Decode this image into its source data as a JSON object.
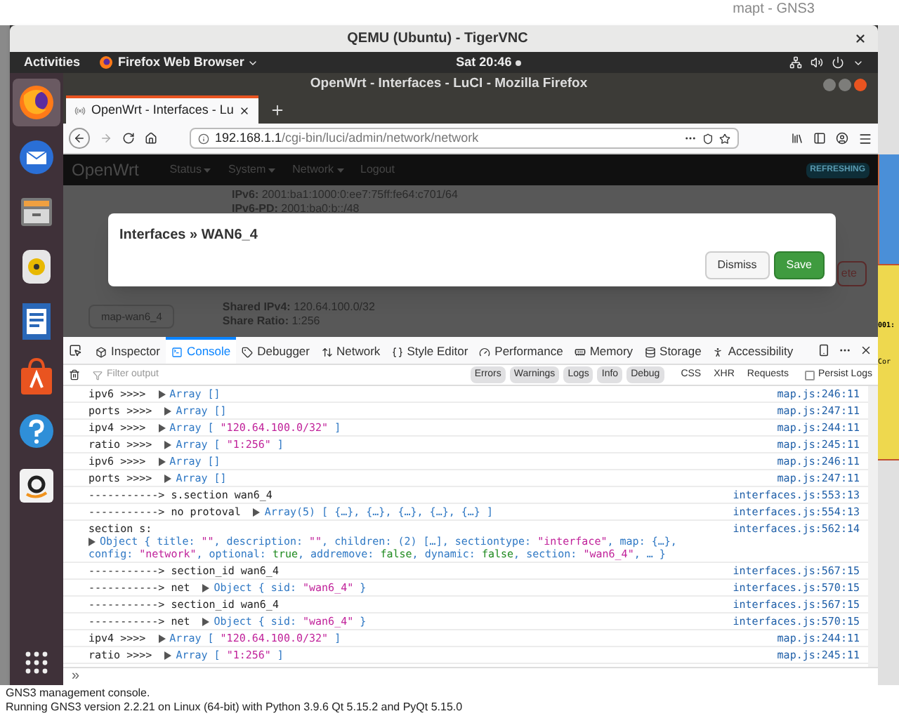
{
  "host": {
    "title": "mapt - GNS3",
    "canvas_labels": [
      "001:",
      "Cor"
    ],
    "console_lines": [
      "GNS3 management console.",
      "Running GNS3 version 2.2.21 on Linux (64-bit) with Python 3.9.6 Qt 5.15.2 and PyQt 5.15.0"
    ]
  },
  "vnc": {
    "title": "QEMU (Ubuntu) - TigerVNC"
  },
  "topbar": {
    "activities": "Activities",
    "app": "Firefox Web Browser",
    "clock": "Sat 20:46"
  },
  "dock": [
    {
      "kind": "firefox",
      "selected": true
    },
    {
      "kind": "mail",
      "selected": false
    },
    {
      "kind": "files",
      "selected": false
    },
    {
      "kind": "speaker",
      "selected": false
    },
    {
      "kind": "document",
      "selected": false
    },
    {
      "kind": "bag",
      "selected": false
    },
    {
      "kind": "help",
      "selected": false
    },
    {
      "kind": "shop",
      "selected": false
    }
  ],
  "browser": {
    "title": "OpenWrt - Interfaces - LuCI - Mozilla Firefox",
    "tab": {
      "title": "OpenWrt - Interfaces - Lu",
      "selected": true
    },
    "url": {
      "host": "192.168.1.1",
      "path": "/cgi-bin/luci/admin/network/network"
    }
  },
  "page": {
    "brand": "OpenWrt",
    "menu": [
      {
        "label": "Status",
        "dropdown": true
      },
      {
        "label": "System",
        "dropdown": true
      },
      {
        "label": "Network",
        "dropdown": true
      },
      {
        "label": "Logout",
        "dropdown": false
      }
    ],
    "badge": "REFRESHING",
    "top_fields": [
      {
        "label": "IPv6:",
        "value": "2001:ba1:1000:0:ee7:75ff:fe64:c701/64"
      },
      {
        "label": "IPv6-PD:",
        "value": "2001:ba0:b::/48"
      }
    ],
    "bottom_fields": [
      {
        "label": "Shared IPv4:",
        "value": "120.64.100.0/32"
      },
      {
        "label": "Share Ratio:",
        "value": "1:256"
      }
    ],
    "section_button": "map-wan6_4",
    "delete_button": "ete"
  },
  "modal": {
    "title": "Interfaces » WAN6_4",
    "buttons": [
      {
        "label": "Dismiss",
        "kind": "default"
      },
      {
        "label": "Save",
        "kind": "primary"
      }
    ]
  },
  "devtools": {
    "tabs": [
      {
        "label": "Inspector",
        "kind": "inspector",
        "selected": false
      },
      {
        "label": "Console",
        "kind": "console",
        "selected": true
      },
      {
        "label": "Debugger",
        "kind": "debugger",
        "selected": false
      },
      {
        "label": "Network",
        "kind": "network",
        "selected": false
      },
      {
        "label": "Style Editor",
        "kind": "style",
        "selected": false
      },
      {
        "label": "Performance",
        "kind": "performance",
        "selected": false
      },
      {
        "label": "Memory",
        "kind": "memory",
        "selected": false
      },
      {
        "label": "Storage",
        "kind": "storage",
        "selected": false
      },
      {
        "label": "Accessibility",
        "kind": "accessibility",
        "selected": false
      }
    ],
    "filter_placeholder": "Filter output",
    "levels": [
      {
        "label": "Errors",
        "on": true
      },
      {
        "label": "Warnings",
        "on": true
      },
      {
        "label": "Logs",
        "on": true
      },
      {
        "label": "Info",
        "on": true
      },
      {
        "label": "Debug",
        "on": true
      },
      {
        "label": "CSS",
        "on": false
      },
      {
        "label": "XHR",
        "on": false
      },
      {
        "label": "Requests",
        "on": false
      }
    ],
    "persist": {
      "label": "Persist Logs",
      "checked": false
    },
    "prompt": "»",
    "messages": [
      {
        "text": "ipv6 >>>>",
        "value": [
          {
            "kind": "type",
            "text": "Array []"
          }
        ],
        "source": "map.js:246:11"
      },
      {
        "text": "ports >>>>",
        "value": [
          {
            "kind": "type",
            "text": "Array []"
          }
        ],
        "source": "map.js:247:11"
      },
      {
        "text": "ipv4 >>>>",
        "value": [
          {
            "kind": "type",
            "text": "Array [ "
          },
          {
            "kind": "str",
            "text": "\"120.64.100.0/32\""
          },
          {
            "kind": "type",
            "text": " ]"
          }
        ],
        "source": "map.js:244:11"
      },
      {
        "text": "ratio >>>>",
        "value": [
          {
            "kind": "type",
            "text": "Array [ "
          },
          {
            "kind": "str",
            "text": "\"1:256\""
          },
          {
            "kind": "type",
            "text": " ]"
          }
        ],
        "source": "map.js:245:11"
      },
      {
        "text": "ipv6 >>>>",
        "value": [
          {
            "kind": "type",
            "text": "Array []"
          }
        ],
        "source": "map.js:246:11"
      },
      {
        "text": "ports >>>>",
        "value": [
          {
            "kind": "type",
            "text": "Array []"
          }
        ],
        "source": "map.js:247:11"
      },
      {
        "text": "-----------> s.section wan6_4",
        "source": "interfaces.js:553:13"
      },
      {
        "text": "-----------> no protoval",
        "value": [
          {
            "kind": "type",
            "text": "Array(5) [ {…}, {…}, {…}, {…}, {…} ]"
          }
        ],
        "source": "interfaces.js:554:13"
      },
      {
        "text": "section s:",
        "wrap": true,
        "value": [
          {
            "kind": "type",
            "text": "Object { title: "
          },
          {
            "kind": "str",
            "text": "\"\""
          },
          {
            "kind": "type",
            "text": ", description: "
          },
          {
            "kind": "str",
            "text": "\"\""
          },
          {
            "kind": "type",
            "text": ", children: (2) […], sectiontype: "
          },
          {
            "kind": "str",
            "text": "\"interface\""
          },
          {
            "kind": "type",
            "text": ", map: {…}, config: "
          },
          {
            "kind": "str",
            "text": "\"network\""
          },
          {
            "kind": "type",
            "text": ", optional: "
          },
          {
            "kind": "bool",
            "text": "true"
          },
          {
            "kind": "type",
            "text": ", addremove: "
          },
          {
            "kind": "bool",
            "text": "false"
          },
          {
            "kind": "type",
            "text": ", dynamic: "
          },
          {
            "kind": "bool",
            "text": "false"
          },
          {
            "kind": "type",
            "text": ", section: "
          },
          {
            "kind": "str",
            "text": "\"wan6_4\""
          },
          {
            "kind": "type",
            "text": ", … }"
          }
        ],
        "source": "interfaces.js:562:14"
      },
      {
        "text": "-----------> section_id wan6_4",
        "source": "interfaces.js:567:15"
      },
      {
        "text": "-----------> net",
        "value": [
          {
            "kind": "type",
            "text": "Object { sid: "
          },
          {
            "kind": "str",
            "text": "\"wan6_4\""
          },
          {
            "kind": "type",
            "text": " }"
          }
        ],
        "source": "interfaces.js:570:15"
      },
      {
        "text": "-----------> section_id wan6_4",
        "source": "interfaces.js:567:15"
      },
      {
        "text": "-----------> net",
        "value": [
          {
            "kind": "type",
            "text": "Object { sid: "
          },
          {
            "kind": "str",
            "text": "\"wan6_4\""
          },
          {
            "kind": "type",
            "text": " }"
          }
        ],
        "source": "interfaces.js:570:15"
      },
      {
        "text": "ipv4 >>>>",
        "value": [
          {
            "kind": "type",
            "text": "Array [ "
          },
          {
            "kind": "str",
            "text": "\"120.64.100.0/32\""
          },
          {
            "kind": "type",
            "text": " ]"
          }
        ],
        "source": "map.js:244:11"
      },
      {
        "text": "ratio >>>>",
        "value": [
          {
            "kind": "type",
            "text": "Array [ "
          },
          {
            "kind": "str",
            "text": "\"1:256\""
          },
          {
            "kind": "type",
            "text": " ]"
          }
        ],
        "source": "map.js:245:11"
      }
    ]
  }
}
